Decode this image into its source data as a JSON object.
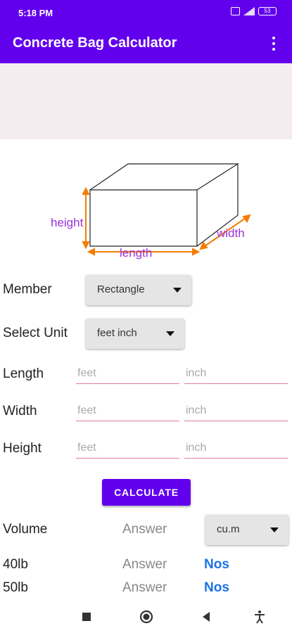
{
  "status": {
    "time": "5:18 PM",
    "battery": "53"
  },
  "appbar": {
    "title": "Concrete Bag Calculator"
  },
  "diagram": {
    "height_label": "height",
    "length_label": "length",
    "width_label": "width"
  },
  "member": {
    "label": "Member",
    "selected": "Rectangle"
  },
  "unit": {
    "label": "Select Unit",
    "selected": "feet inch"
  },
  "dimensions": {
    "length": {
      "label": "Length",
      "feet_placeholder": "feet",
      "inch_placeholder": "inch"
    },
    "width": {
      "label": "Width",
      "feet_placeholder": "feet",
      "inch_placeholder": "inch"
    },
    "height": {
      "label": "Height",
      "feet_placeholder": "feet",
      "inch_placeholder": "inch"
    }
  },
  "calculate_label": "CALCULATE",
  "results": {
    "volume": {
      "label": "Volume",
      "answer": "Answer",
      "unit_selected": "cu.m"
    },
    "bag40": {
      "label": "40lb",
      "answer": "Answer",
      "unit": "Nos"
    },
    "bag50": {
      "label": "50lb",
      "answer": "Answer",
      "unit": "Nos"
    }
  },
  "colors": {
    "primary": "#6200ee",
    "accent_diagram": "#9b30d9",
    "arrow": "#f57c00",
    "nos": "#1a73e8",
    "underline": "#e57b91"
  },
  "icons": [
    "overflow-menu-icon",
    "recents-icon",
    "home-icon",
    "back-icon",
    "accessibility-icon"
  ]
}
